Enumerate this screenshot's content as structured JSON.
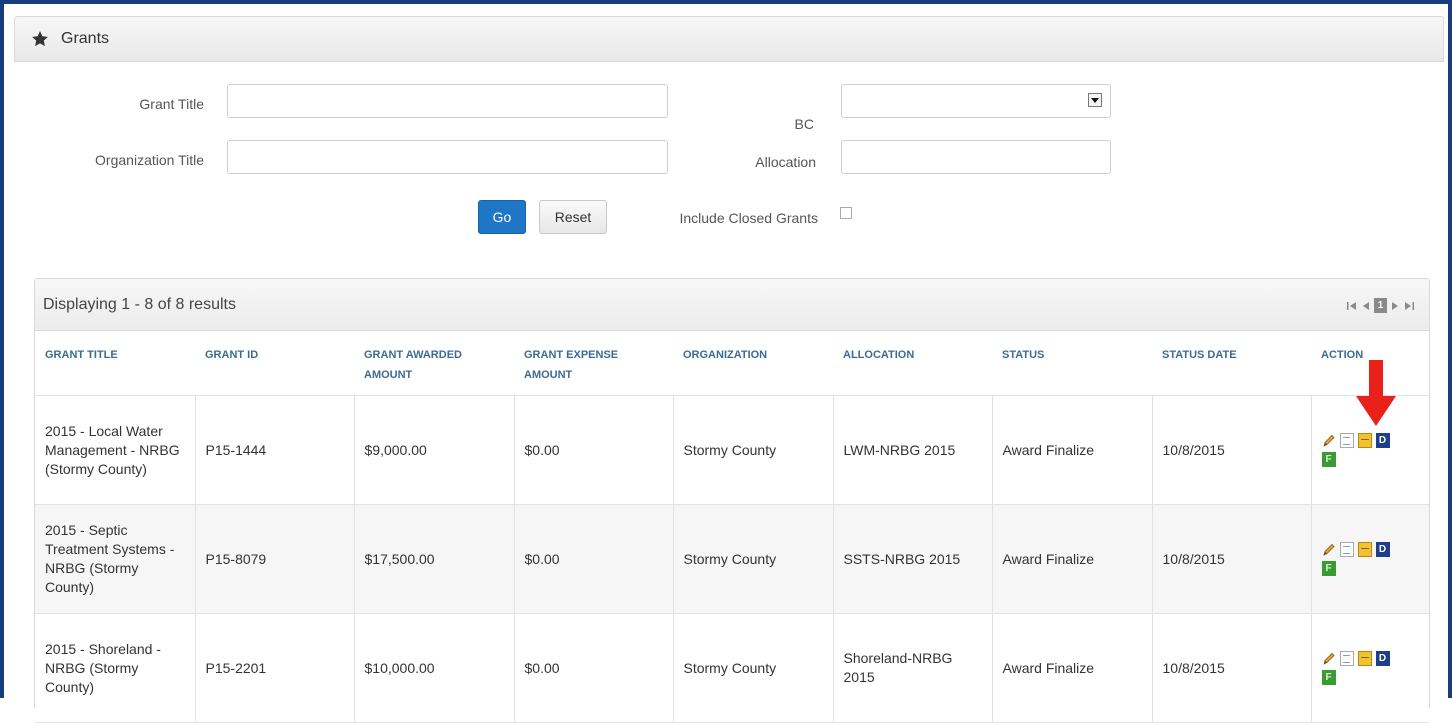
{
  "panel": {
    "title": "Grants",
    "icon": "star-icon"
  },
  "filters": {
    "grant_title_label": "Grant Title",
    "grant_title_value": "",
    "org_title_label": "Organization Title",
    "org_title_value": "",
    "bc_label": "BC",
    "bc_value": "",
    "allocation_label": "Allocation",
    "allocation_value": "",
    "go_label": "Go",
    "reset_label": "Reset",
    "include_closed_label": "Include Closed Grants",
    "include_closed_checked": false
  },
  "results": {
    "summary": "Displaying 1 - 8 of 8 results",
    "pager": {
      "first_icon": "first-page-icon",
      "prev_icon": "prev-page-icon",
      "current_page": "1",
      "next_icon": "next-page-icon",
      "last_icon": "last-page-icon"
    },
    "columns": [
      "GRANT TITLE",
      "GRANT ID",
      "GRANT AWARDED AMOUNT",
      "GRANT EXPENSE AMOUNT",
      "ORGANIZATION",
      "ALLOCATION",
      "STATUS",
      "STATUS DATE",
      "ACTION"
    ],
    "rows": [
      {
        "title": "2015 - Local Water Management - NRBG (Stormy County)",
        "id": "P15-1444",
        "awarded": "$9,000.00",
        "expense": "$0.00",
        "organization": "Stormy County",
        "allocation": "LWM-NRBG 2015",
        "status": "Award Finalize",
        "status_date": "10/8/2015",
        "actions": [
          "edit-pencil-icon",
          "document-icon",
          "note-icon",
          "D",
          "F"
        ]
      },
      {
        "title": "2015 - Septic Treatment Systems - NRBG (Stormy County)",
        "id": "P15-8079",
        "awarded": "$17,500.00",
        "expense": "$0.00",
        "organization": "Stormy County",
        "allocation": "SSTS-NRBG 2015",
        "status": "Award Finalize",
        "status_date": "10/8/2015",
        "actions": [
          "edit-pencil-icon",
          "document-icon",
          "note-icon",
          "D",
          "F"
        ]
      },
      {
        "title": "2015 - Shoreland - NRBG (Stormy County)",
        "id": "P15-2201",
        "awarded": "$10,000.00",
        "expense": "$0.00",
        "organization": "Stormy County",
        "allocation": "Shoreland-NRBG 2015",
        "status": "Award Finalize",
        "status_date": "10/8/2015",
        "actions": [
          "edit-pencil-icon",
          "document-icon",
          "note-icon",
          "D",
          "F"
        ]
      }
    ]
  },
  "annotation": {
    "icon": "red-down-arrow-icon",
    "color": "#e8211b"
  },
  "colors": {
    "frame": "#173d7c",
    "go_button": "#1f76c6",
    "header_text": "#3d6a94"
  }
}
